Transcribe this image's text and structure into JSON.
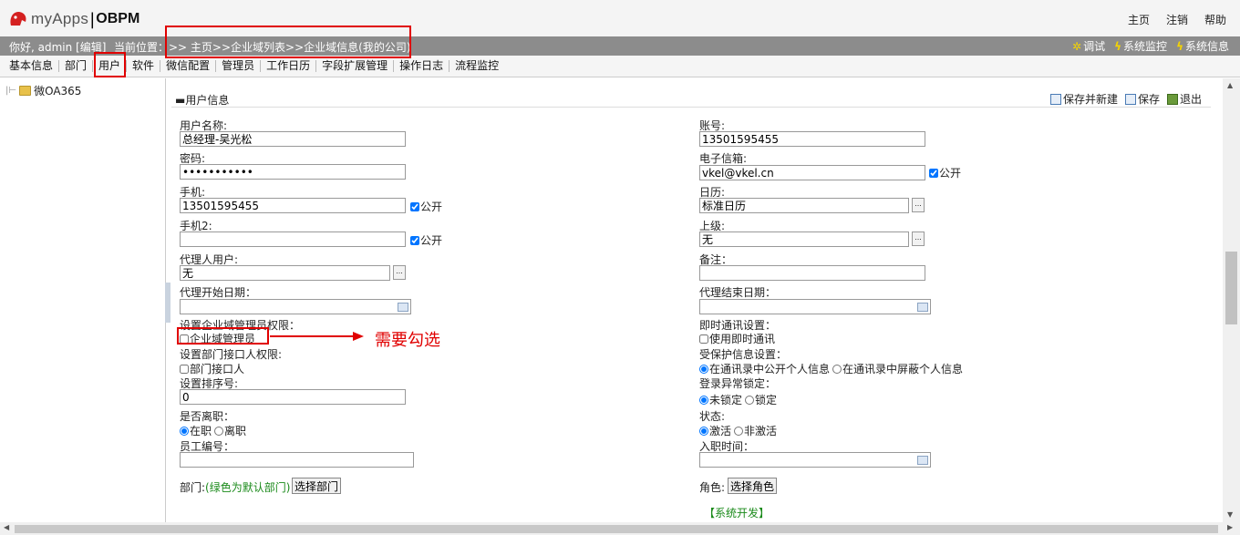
{
  "header": {
    "logo_name": "myApps",
    "logo_product": "OBPM",
    "links": [
      "主页",
      "注销",
      "帮助"
    ]
  },
  "infobar": {
    "greeting": "你好, admin [编辑]",
    "location_label": "当前位置：",
    "breadcrumb": ">> 主页>>企业域列表>>企业域信息(我的公司)",
    "tools": [
      "调试",
      "系统监控",
      "系统信息"
    ]
  },
  "tabs": [
    "基本信息",
    "部门",
    "用户",
    "软件",
    "微信配置",
    "管理员",
    "工作日历",
    "字段扩展管理",
    "操作日志",
    "流程监控"
  ],
  "tree": {
    "root": "微OA365"
  },
  "section": {
    "title": "用户信息",
    "actions": [
      "保存并新建",
      "保存",
      "退出"
    ]
  },
  "form": {
    "username_label": "用户名称:",
    "username_value": "总经理-吴光松",
    "account_label": "账号:",
    "account_value": "13501595455",
    "password_label": "密码:",
    "password_value": "•••••••••••",
    "email_label": "电子信箱:",
    "email_value": "vkel@vkel.cn",
    "public_label": "公开",
    "mobile_label": "手机:",
    "mobile_value": "13501595455",
    "calendar_label": "日历:",
    "calendar_value": "标准日历",
    "mobile2_label": "手机2:",
    "mobile2_value": "",
    "superior_label": "上级:",
    "superior_value": "无",
    "proxy_label": "代理人用户:",
    "proxy_value": "无",
    "remark_label": "备注：",
    "proxy_start_label": "代理开始日期：",
    "proxy_end_label": "代理结束日期：",
    "domain_admin_perm_label": "设置企业域管理员权限：",
    "domain_admin_checkbox": "企业域管理员",
    "im_label": "即时通讯设置：",
    "im_checkbox": "使用即时通讯",
    "dept_interface_label": "设置部门接口人权限:",
    "dept_interface_checkbox": "部门接口人",
    "protect_label": "受保护信息设置：",
    "protect_options": [
      "在通讯录中公开个人信息",
      "在通讯录中屏蔽个人信息"
    ],
    "sort_label": "设置排序号:",
    "sort_value": "0",
    "lock_label": "登录异常锁定：",
    "lock_options": [
      "未锁定",
      "锁定"
    ],
    "resign_label": "是否离职：",
    "resign_options": [
      "在职",
      "离职"
    ],
    "status_label": "状态:",
    "status_options": [
      "激活",
      "非激活"
    ],
    "empno_label": "员工编号：",
    "hire_label": "入职时间：",
    "dept_label": "部门:",
    "dept_hint": "(绿色为默认部门)",
    "dept_button": "选择部门",
    "role_label": "角色:",
    "role_button": "选择角色",
    "role_value": "【系统开发】"
  },
  "annotation": {
    "note": "需要勾选"
  },
  "colors": {
    "annotation_red": "#e00000",
    "infobar_grey": "#8c8c8c",
    "role_green": "#1a8a1a"
  }
}
